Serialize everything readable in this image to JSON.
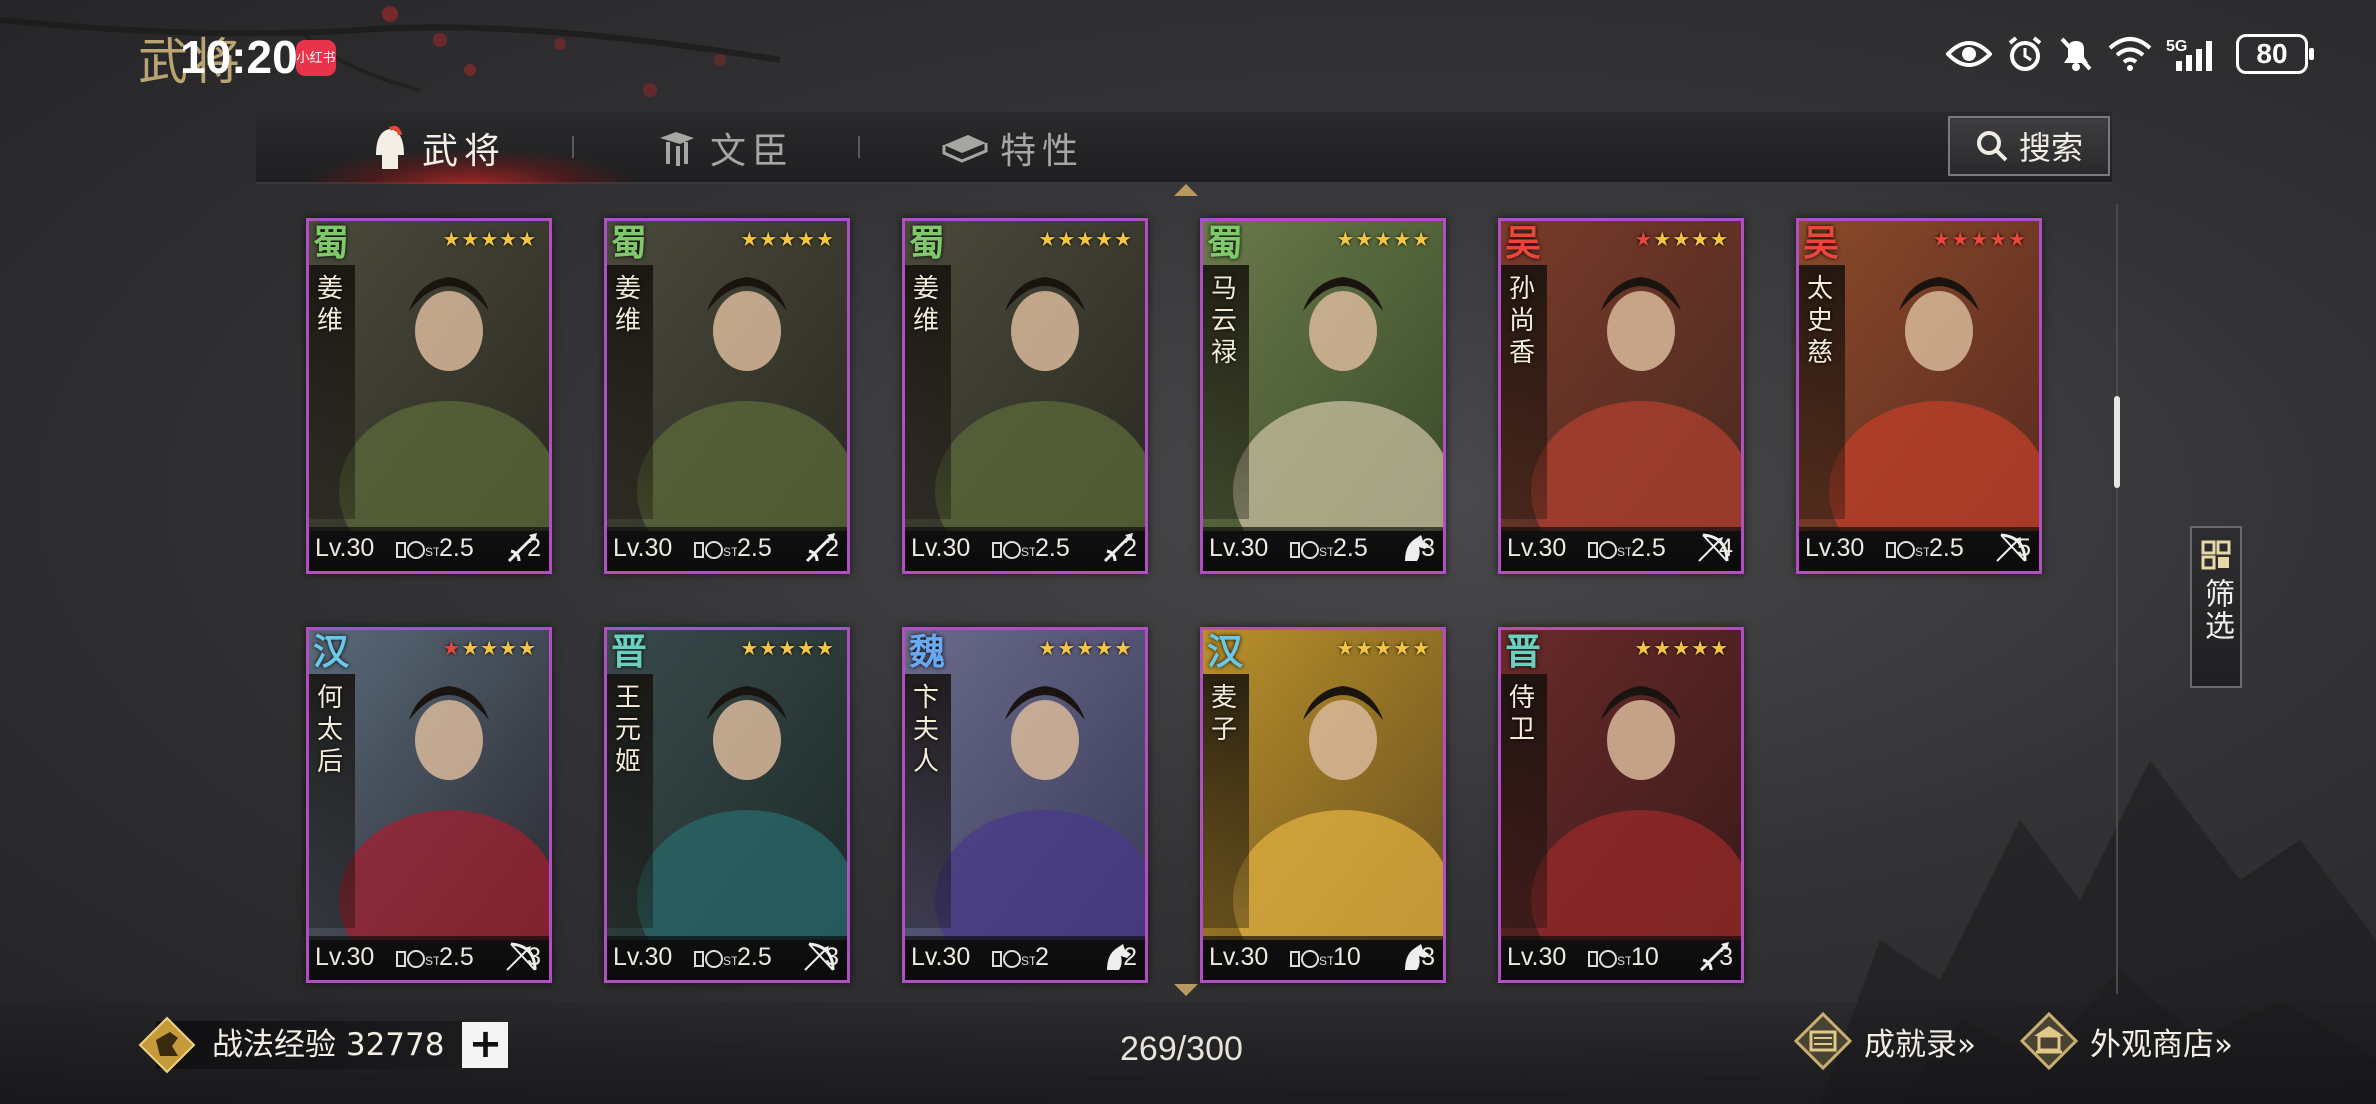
{
  "status_bar": {
    "page_title_bg": "武将",
    "time": "10:20",
    "notif_badge": "小红书",
    "battery": "80"
  },
  "tabs": [
    {
      "label": "武将",
      "active": true,
      "icon": "helmet-icon"
    },
    {
      "label": "文臣",
      "active": false,
      "icon": "scroll-icon"
    },
    {
      "label": "特性",
      "active": false,
      "icon": "book-stack-icon"
    }
  ],
  "search": {
    "label": "搜索"
  },
  "filter": {
    "label": "筛选"
  },
  "cards": [
    {
      "faction": "蜀",
      "faction_color": "#7fc96a",
      "name": "姜维",
      "stars": 5,
      "red_stars": 0,
      "level": "Lv.30",
      "cost": "2.5",
      "arm_icon": "spear-icon",
      "arm_count": "2",
      "palette": [
        "#4a4a3c",
        "#2a2a22",
        "#5c6a3a"
      ]
    },
    {
      "faction": "蜀",
      "faction_color": "#7fc96a",
      "name": "姜维",
      "stars": 5,
      "red_stars": 0,
      "level": "Lv.30",
      "cost": "2.5",
      "arm_icon": "spear-icon",
      "arm_count": "2",
      "palette": [
        "#4a4a3c",
        "#2a2a22",
        "#5c6a3a"
      ]
    },
    {
      "faction": "蜀",
      "faction_color": "#7fc96a",
      "name": "姜维",
      "stars": 5,
      "red_stars": 0,
      "level": "Lv.30",
      "cost": "2.5",
      "arm_icon": "spear-icon",
      "arm_count": "2",
      "palette": [
        "#4a4a3c",
        "#2a2a22",
        "#5c6a3a"
      ]
    },
    {
      "faction": "蜀",
      "faction_color": "#7fc96a",
      "name": "马云禄",
      "stars": 5,
      "red_stars": 0,
      "level": "Lv.30",
      "cost": "2.5",
      "arm_icon": "horse-icon",
      "arm_count": "3",
      "palette": [
        "#6a7a4a",
        "#3a4a2a",
        "#c8c0a0"
      ]
    },
    {
      "faction": "吴",
      "faction_color": "#e8473a",
      "name": "孙尚香",
      "stars": 5,
      "red_stars": 1,
      "level": "Lv.30",
      "cost": "2.5",
      "arm_icon": "bow-icon",
      "arm_count": "4",
      "palette": [
        "#7a3a2a",
        "#4a2a20",
        "#b04030"
      ]
    },
    {
      "faction": "吴",
      "faction_color": "#e8473a",
      "name": "太史慈",
      "stars": 5,
      "red_stars": 5,
      "level": "Lv.30",
      "cost": "2.5",
      "arm_icon": "bow-icon",
      "arm_count": "5",
      "palette": [
        "#8a4a2a",
        "#5a2a20",
        "#c0402a"
      ]
    },
    {
      "faction": "汉",
      "faction_color": "#6ac8e8",
      "name": "何太后",
      "stars": 5,
      "red_stars": 1,
      "level": "Lv.30",
      "cost": "2.5",
      "arm_icon": "bow-icon",
      "arm_count": "3",
      "palette": [
        "#5a6a7a",
        "#2a2a30",
        "#a02030"
      ]
    },
    {
      "faction": "晋",
      "faction_color": "#6ad0c0",
      "name": "王元姬",
      "stars": 5,
      "red_stars": 0,
      "level": "Lv.30",
      "cost": "2.5",
      "arm_icon": "bow-icon",
      "arm_count": "3",
      "palette": [
        "#3a4a4a",
        "#1e2a2a",
        "#2a6a6a"
      ]
    },
    {
      "faction": "魏",
      "faction_color": "#6aa8f0",
      "name": "卞夫人",
      "stars": 5,
      "red_stars": 0,
      "level": "Lv.30",
      "cost": "2",
      "arm_icon": "horse-icon",
      "arm_count": "2",
      "palette": [
        "#6a6a8a",
        "#3a3a5a",
        "#4a3a8a"
      ]
    },
    {
      "faction": "汉",
      "faction_color": "#6ac8e8",
      "name": "麦子",
      "stars": 5,
      "red_stars": 0,
      "level": "Lv.30",
      "cost": "10",
      "arm_icon": "horse-icon",
      "arm_count": "3",
      "palette": [
        "#b8902a",
        "#6a5020",
        "#e0b040"
      ]
    },
    {
      "faction": "晋",
      "faction_color": "#6ad0c0",
      "name": "侍卫",
      "stars": 5,
      "red_stars": 0,
      "level": "Lv.30",
      "cost": "10",
      "arm_icon": "spear-icon",
      "arm_count": "3",
      "palette": [
        "#6a2a2a",
        "#3a1a1a",
        "#9a2a2a"
      ]
    }
  ],
  "bottom": {
    "exp_label": "战法经验 32778",
    "plus": "+",
    "count": "269/300",
    "achievement_label": "成就录»",
    "shop_label": "外观商店»"
  }
}
